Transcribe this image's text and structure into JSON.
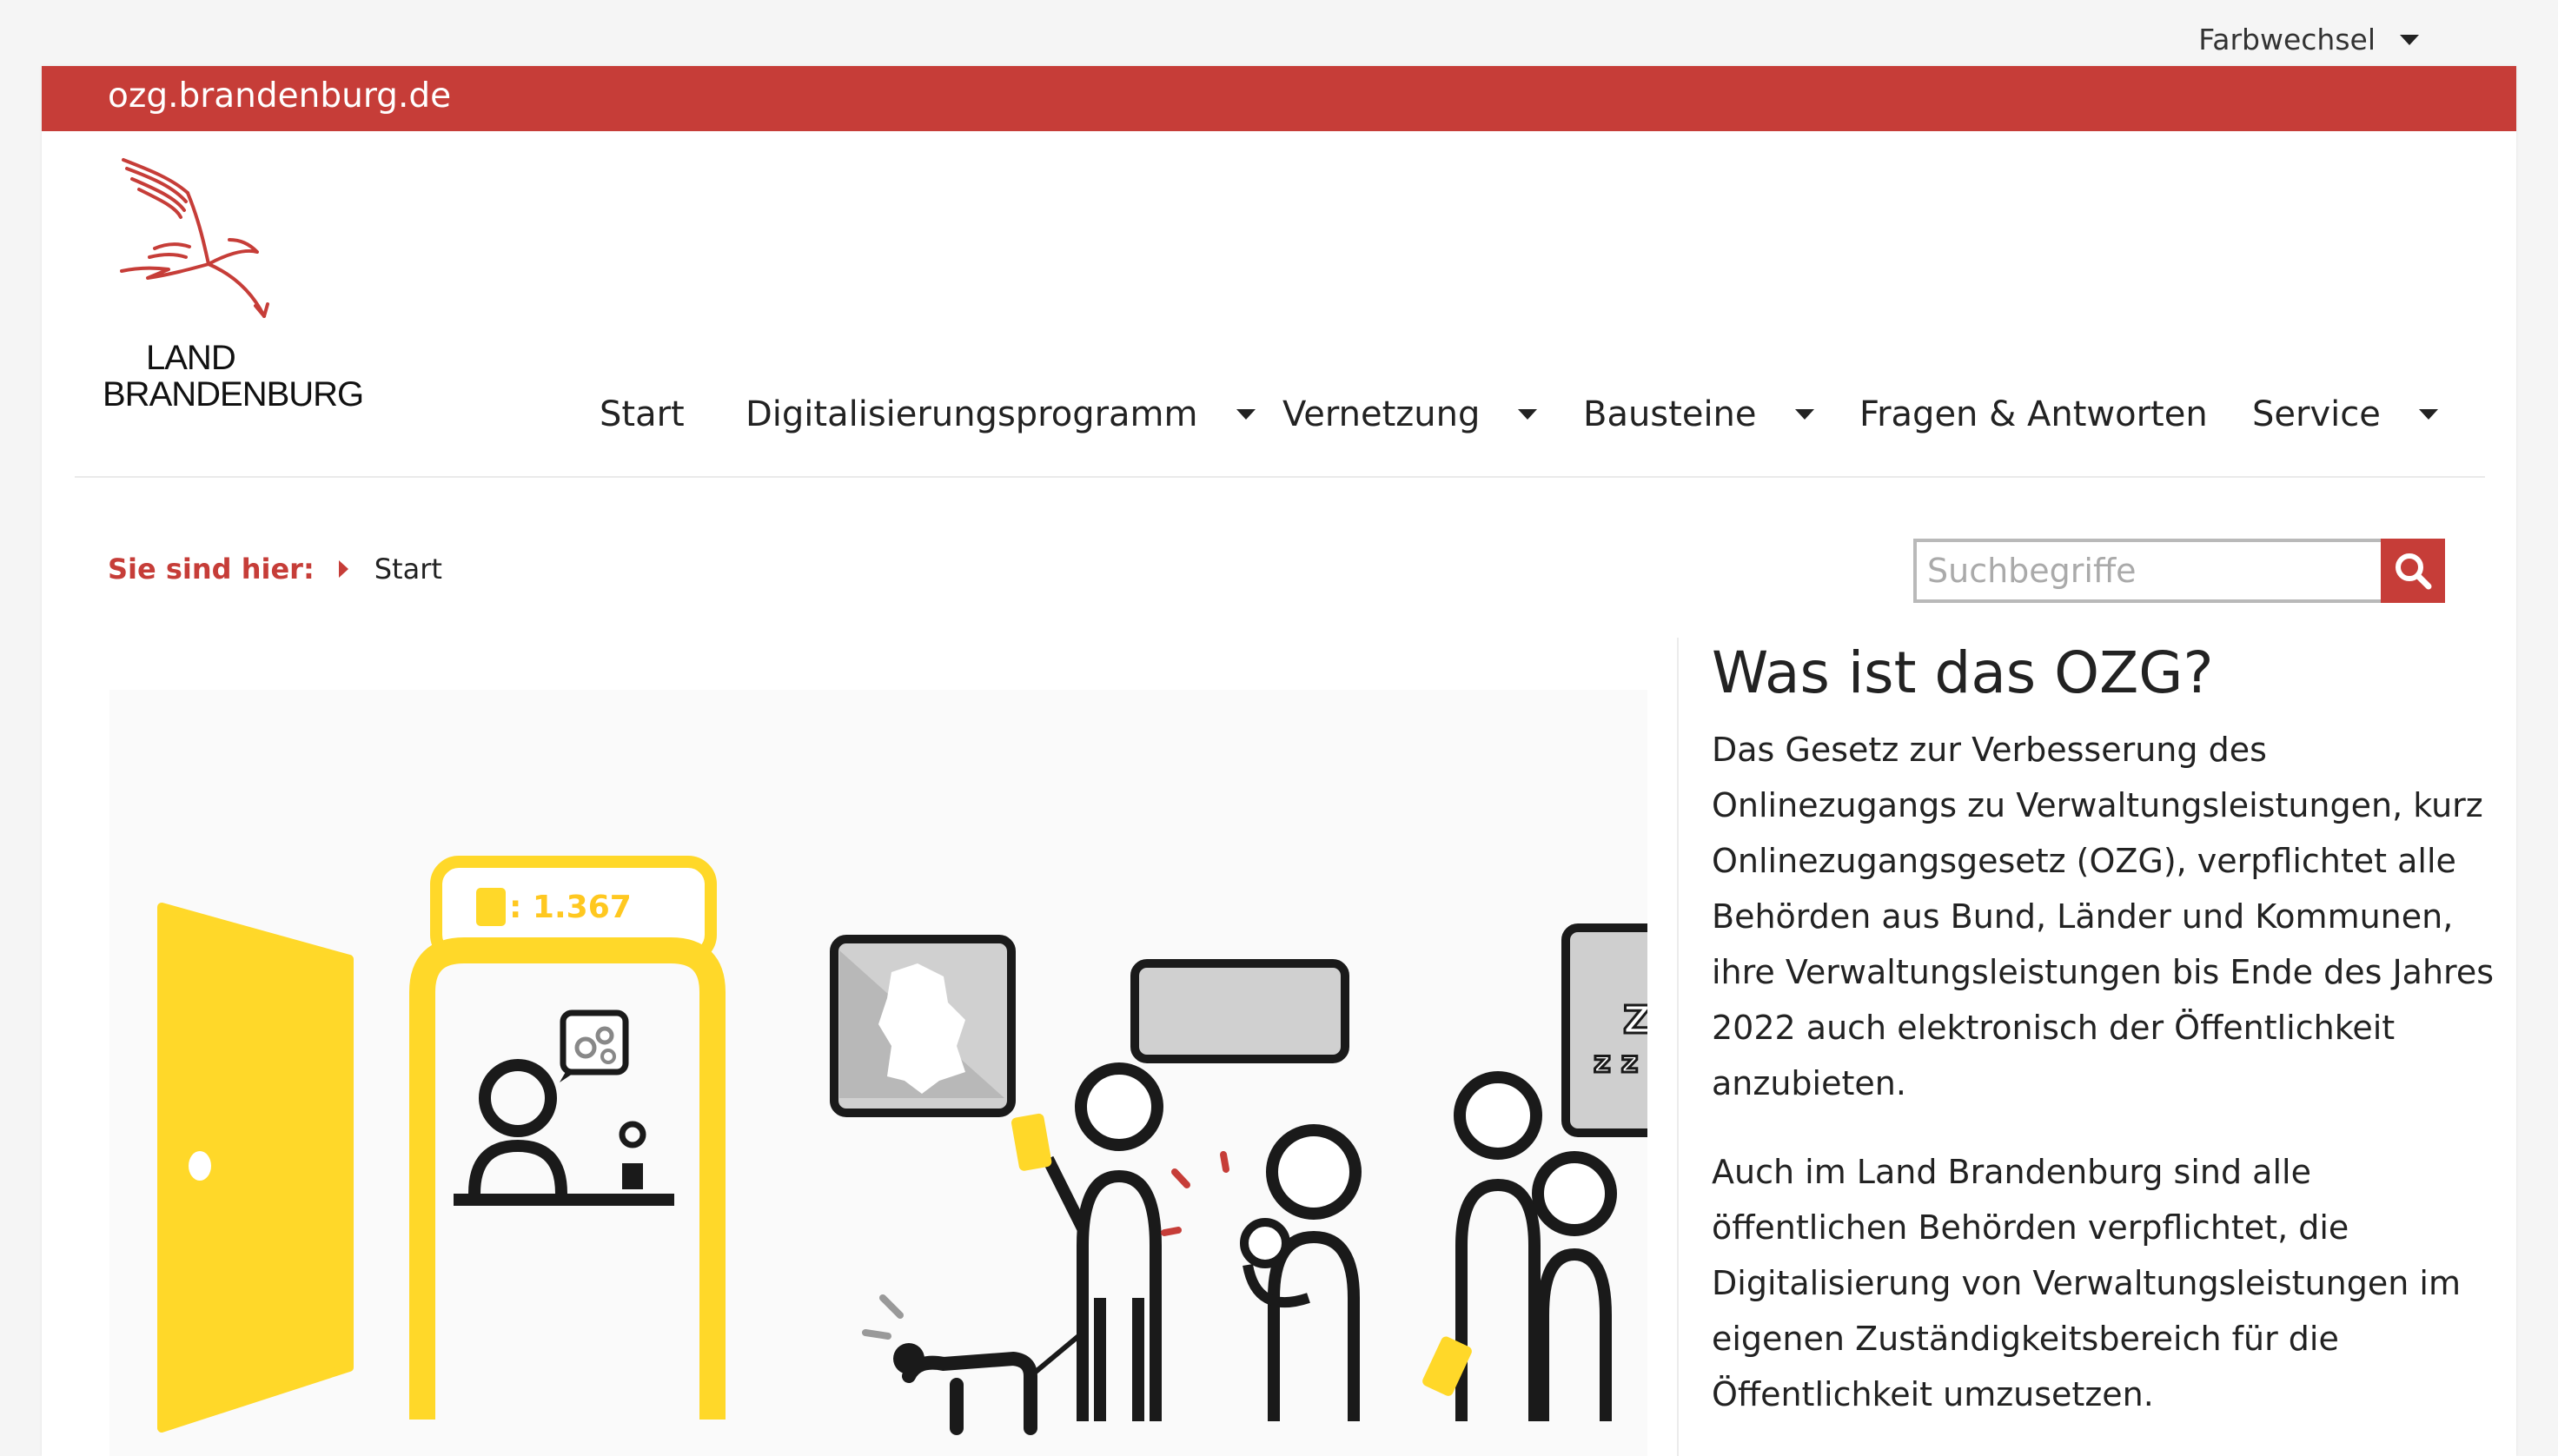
{
  "top": {
    "color_switch_label": "Farbwechsel"
  },
  "site": {
    "domain": "ozg.brandenburg.de"
  },
  "logo": {
    "line1": "LAND",
    "line2": "BRANDENBURG"
  },
  "nav": {
    "items": [
      {
        "label": "Start",
        "has_dropdown": false
      },
      {
        "label": "Digitalisierungsprogramm",
        "has_dropdown": true
      },
      {
        "label": "Vernetzung",
        "has_dropdown": true
      },
      {
        "label": "Bausteine",
        "has_dropdown": true
      },
      {
        "label": "Fragen & Antworten",
        "has_dropdown": false
      },
      {
        "label": "Service",
        "has_dropdown": true
      }
    ]
  },
  "breadcrumb": {
    "label": "Sie sind hier:",
    "current": "Start"
  },
  "search": {
    "placeholder": "Suchbegriffe",
    "value": ""
  },
  "illustration": {
    "counter_text": ": 1.367"
  },
  "article": {
    "title": "Was ist das OZG?",
    "paragraphs": [
      "Das Gesetz zur Verbesserung des Onlinezugangs zu Verwaltungsleistungen, kurz Onlinezugangsgesetz (OZG), verpflichtet alle Behörden aus Bund, Länder und Kommunen, ihre Verwaltungsleistungen bis Ende des Jahres 2022 auch elektronisch der Öffentlichkeit anzubieten.",
      "Auch im Land Brandenburg sind alle öffentlichen Behörden verpflichtet, die Digitalisierung von Verwaltungsleistungen im eigenen Zuständigkeitsbereich für die Öffentlichkeit umzusetzen."
    ]
  },
  "colors": {
    "brand_red": "#c63d38",
    "accent_yellow": "#ffd829",
    "dark": "#1a1a1a"
  }
}
